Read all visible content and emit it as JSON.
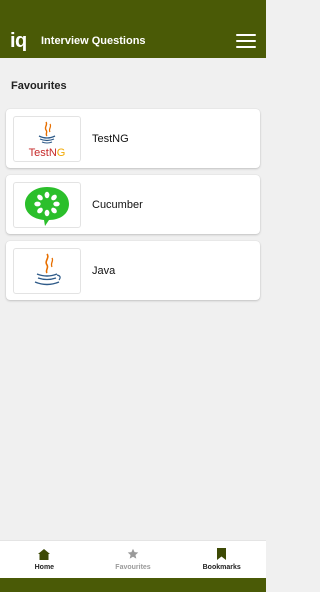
{
  "app": {
    "logo": "iq",
    "title": "Interview Questions"
  },
  "section": {
    "title": "Favourites"
  },
  "favourites": [
    {
      "label": "TestNG",
      "icon": "testng-logo"
    },
    {
      "label": "Cucumber",
      "icon": "cucumber-logo"
    },
    {
      "label": "Java",
      "icon": "java-logo"
    }
  ],
  "bottom_nav": [
    {
      "label": "Home",
      "icon": "home-icon",
      "active": true
    },
    {
      "label": "Favourites",
      "icon": "star-icon",
      "active": false
    },
    {
      "label": "Bookmarks",
      "icon": "bookmark-icon",
      "active": true
    }
  ],
  "colors": {
    "primary": "#4a5a06",
    "cucumber_green": "#2bbf2b",
    "java_orange": "#e76f00",
    "java_blue": "#2e5a88",
    "inactive": "#9a9a9a"
  }
}
